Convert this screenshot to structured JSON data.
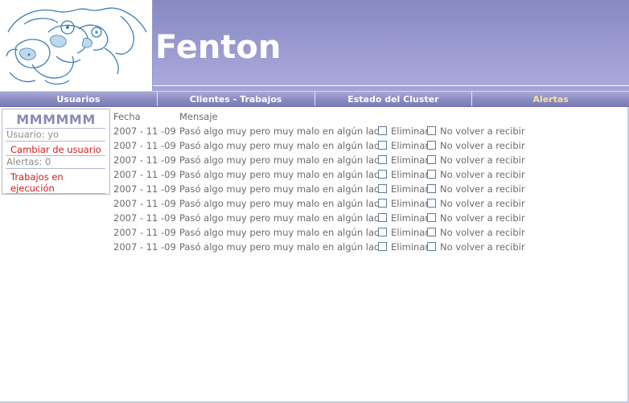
{
  "app": {
    "title": "Fenton"
  },
  "nav": {
    "items": [
      {
        "label": "Usuarios",
        "active": false
      },
      {
        "label": "Clientes - Trabajos",
        "active": false
      },
      {
        "label": "Estado del Cluster",
        "active": false
      },
      {
        "label": "Alertas",
        "active": true
      }
    ]
  },
  "sidebar": {
    "username": "MMMMMM",
    "user_line": "Usuario: yo",
    "change_user_link": "Cambiar de usuario",
    "alerts_line": "Alertas: 0",
    "jobs_link": "Trabajos en ejecución"
  },
  "alerts_table": {
    "headers": {
      "date": "Fecha",
      "message": "Mensaje"
    },
    "rows": [
      {
        "date": "2007 - 11 -09",
        "message": "Pasó algo muy pero muy malo en algún lado",
        "delete_label": "Eliminar",
        "no_receive_label": "No volver a recibir"
      },
      {
        "date": "2007 - 11 -09",
        "message": "Pasó algo muy pero muy malo en algún lado",
        "delete_label": "Eliminar",
        "no_receive_label": "No volver a recibir"
      },
      {
        "date": "2007 - 11 -09",
        "message": "Pasó algo muy pero muy malo en algún lado",
        "delete_label": "Eliminar",
        "no_receive_label": "No volver a recibir"
      },
      {
        "date": "2007 - 11 -09",
        "message": "Pasó algo muy pero muy malo en algún lado",
        "delete_label": "Eliminar",
        "no_receive_label": "No volver a recibir"
      },
      {
        "date": "2007 - 11 -09",
        "message": "Pasó algo muy pero muy malo en algún lado",
        "delete_label": "Eliminar",
        "no_receive_label": "No volver a recibir"
      },
      {
        "date": "2007 - 11 -09",
        "message": "Pasó algo muy pero muy malo en algún lado",
        "delete_label": "Eliminar",
        "no_receive_label": "No volver a recibir"
      },
      {
        "date": "2007 - 11 -09",
        "message": "Pasó algo muy pero muy malo en algún lado",
        "delete_label": "Eliminar",
        "no_receive_label": "No volver a recibir"
      },
      {
        "date": "2007 - 11 -09",
        "message": "Pasó algo muy pero muy malo en algún lado",
        "delete_label": "Eliminar",
        "no_receive_label": "No volver a recibir"
      },
      {
        "date": "2007 - 11 -09",
        "message": "Pasó algo muy pero muy malo en algún lado",
        "delete_label": "Eliminar",
        "no_receive_label": "No volver a recibir"
      }
    ]
  },
  "colors": {
    "banner": "#8e8ec6",
    "nav_active_text": "#f2e69a",
    "link_red": "#d11c1c",
    "username_text": "#8a8ab8"
  },
  "logo_icon": "cartoon-character-logo"
}
